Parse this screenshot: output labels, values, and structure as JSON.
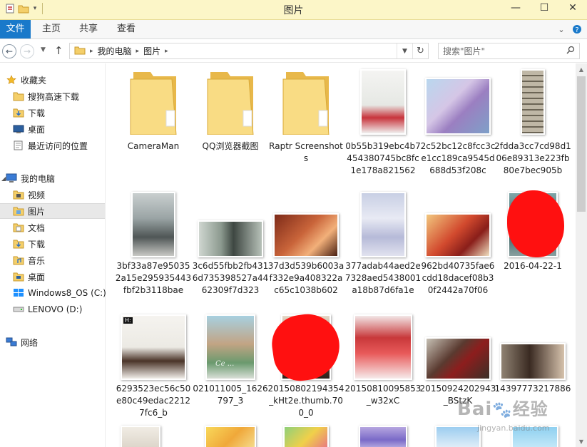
{
  "window": {
    "title": "图片"
  },
  "quick_access": {
    "icons": [
      "properties-icon",
      "new-folder-icon",
      "customize-toolbar-dropdown-icon"
    ]
  },
  "ribbon": {
    "tabs": [
      {
        "label": "文件",
        "active": true
      },
      {
        "label": "主页"
      },
      {
        "label": "共享"
      },
      {
        "label": "查看"
      }
    ]
  },
  "nav": {
    "breadcrumbs": [
      "我的电脑",
      "图片"
    ],
    "search_placeholder": "搜索\"图片\""
  },
  "sidebar": {
    "favorites_header": "收藏夹",
    "favorites": [
      "搜狗高速下载",
      "下载",
      "桌面",
      "最近访问的位置"
    ],
    "computer_header": "我的电脑",
    "computer": [
      "视频",
      "图片",
      "文档",
      "下载",
      "音乐",
      "桌面",
      "Windows8_OS (C:)",
      "LENOVO (D:)"
    ],
    "network_header": "网络",
    "selected": "图片"
  },
  "files": [
    {
      "name": "CameraMan",
      "type": "folder"
    },
    {
      "name": "QQ浏览器截图",
      "type": "folder"
    },
    {
      "name": "Raptr Screenshots",
      "type": "folder"
    },
    {
      "name": "0b55b319ebc4b7454380745bc8fc1e178a821562",
      "type": "image"
    },
    {
      "name": "2c52bc12c8fcc3ce1cc189ca9545d688d53f208c",
      "type": "image"
    },
    {
      "name": "2fdda3cc7cd98d106e89313e223fb80e7bec905b",
      "type": "image"
    },
    {
      "name": "3bf33a87e950352a15e295935443fbf2b3118bae",
      "type": "image"
    },
    {
      "name": "3c6d55fbb2fb4316d735398527a4462309f7d323",
      "type": "image"
    },
    {
      "name": "37d3d539b6003af332e9a408322ac65c1038b602",
      "type": "image"
    },
    {
      "name": "377adab44aed2e7328aed5438001a18b87d6fa1e",
      "type": "image"
    },
    {
      "name": "962bd40735fae6cdd18dacef08b30f2442a70f06",
      "type": "image"
    },
    {
      "name": "2016-04-22-1",
      "type": "image"
    },
    {
      "name": "6293523ec56c50e80c49edac22127fc6_b",
      "type": "image"
    },
    {
      "name": "021011005_1626797_3",
      "type": "image"
    },
    {
      "name": "20150802194354_kHt2e.thumb.700_0",
      "type": "image"
    },
    {
      "name": "20150810095853_w32xC",
      "type": "image"
    },
    {
      "name": "20150924202943_BStzK",
      "type": "image"
    },
    {
      "name": "14397773217886",
      "type": "image"
    }
  ],
  "overlays": {
    "thumb_badge": "H:",
    "photo_signature": "Ce ..."
  },
  "watermark": {
    "brand": "Bai",
    "brand2": "经验",
    "url": "jingyan.baidu.com"
  },
  "colors": {
    "title_bar": "#fcf6c8",
    "file_tab": "#1979ca",
    "folder_yellow": "#f4cf6a",
    "selected_bg": "#e8e8e8",
    "redaction": "#ff1010"
  }
}
